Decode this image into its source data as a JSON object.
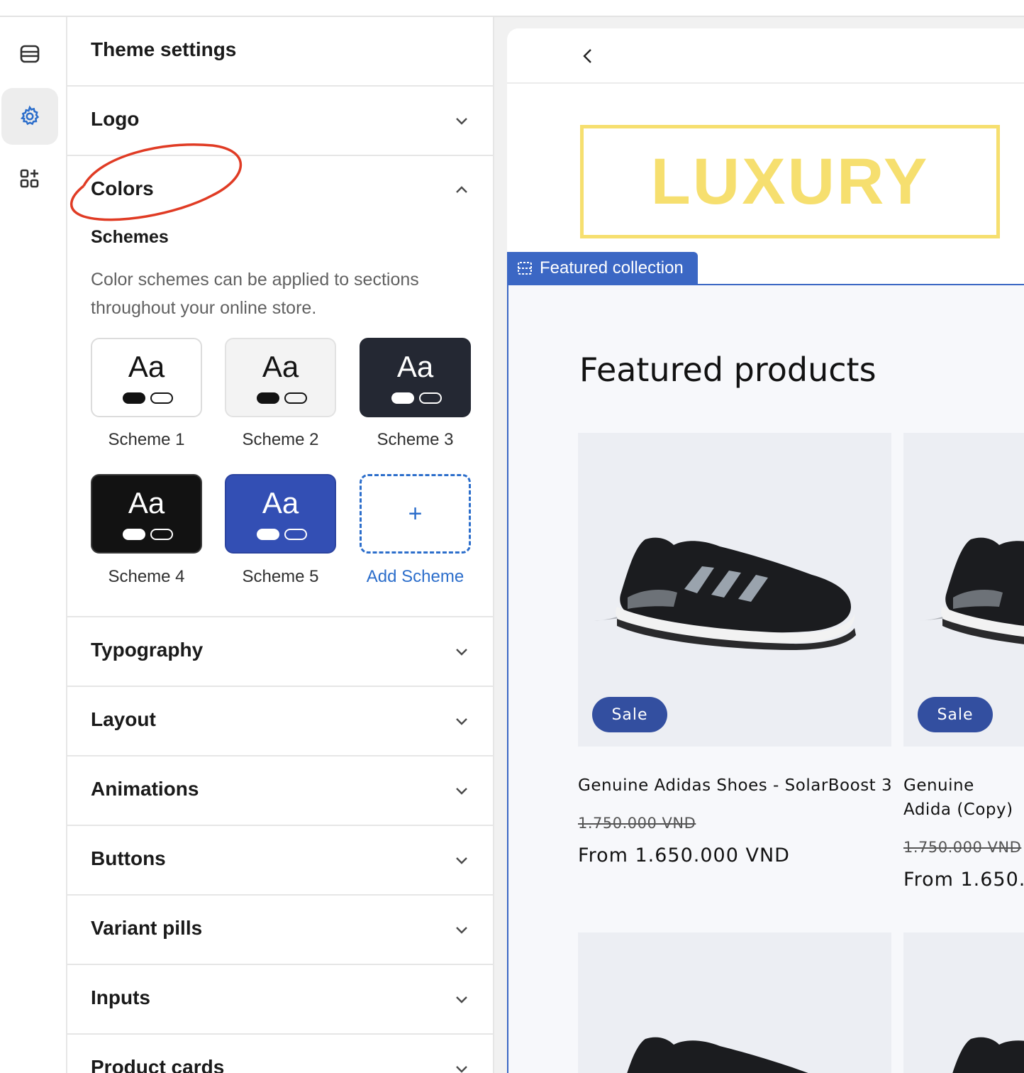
{
  "sidebar": {
    "title": "Theme settings",
    "rail": [
      {
        "icon": "sections-icon"
      },
      {
        "icon": "gear-icon",
        "active": true
      },
      {
        "icon": "apps-icon"
      }
    ],
    "sections": {
      "logo": "Logo",
      "colors": "Colors",
      "typography": "Typography",
      "layout": "Layout",
      "animations": "Animations",
      "buttons": "Buttons",
      "variant_pills": "Variant pills",
      "inputs": "Inputs",
      "product_cards": "Product cards"
    },
    "colors": {
      "schemes_title": "Schemes",
      "description": "Color schemes can be applied to sections throughout your online store.",
      "schemes": [
        {
          "preview": "Aa",
          "label": "Scheme 1",
          "bg": "#ffffff",
          "text": "#121212"
        },
        {
          "preview": "Aa",
          "label": "Scheme 2",
          "bg": "#f3f3f3",
          "text": "#121212"
        },
        {
          "preview": "Aa",
          "label": "Scheme 3",
          "bg": "#242833",
          "text": "#ffffff"
        },
        {
          "preview": "Aa",
          "label": "Scheme 4",
          "bg": "#121212",
          "text": "#ffffff"
        },
        {
          "preview": "Aa",
          "label": "Scheme 5",
          "bg": "#334fb4",
          "text": "#ffffff"
        }
      ],
      "add_label": "Add Scheme",
      "add_symbol": "+"
    }
  },
  "preview": {
    "logo_text": "LUXURY",
    "logo_color": "#f6df6f",
    "section_tag": "Featured collection",
    "section_title": "Featured products",
    "products": [
      {
        "name": "Genuine Adidas Shoes - SolarBoost 3",
        "badge": "Sale",
        "compare_price": "1.750.000 VND",
        "price": "From 1.650.000 VND"
      },
      {
        "name": "Genuine Adida (Copy)",
        "badge": "Sale",
        "compare_price": "1.750.000 VND",
        "price": "From 1.650."
      }
    ]
  },
  "colors": {
    "accent": "#2c6ecb",
    "tag_blue": "#3b67c4",
    "sale_badge": "#334fa0",
    "annotation": "#e03b24"
  }
}
